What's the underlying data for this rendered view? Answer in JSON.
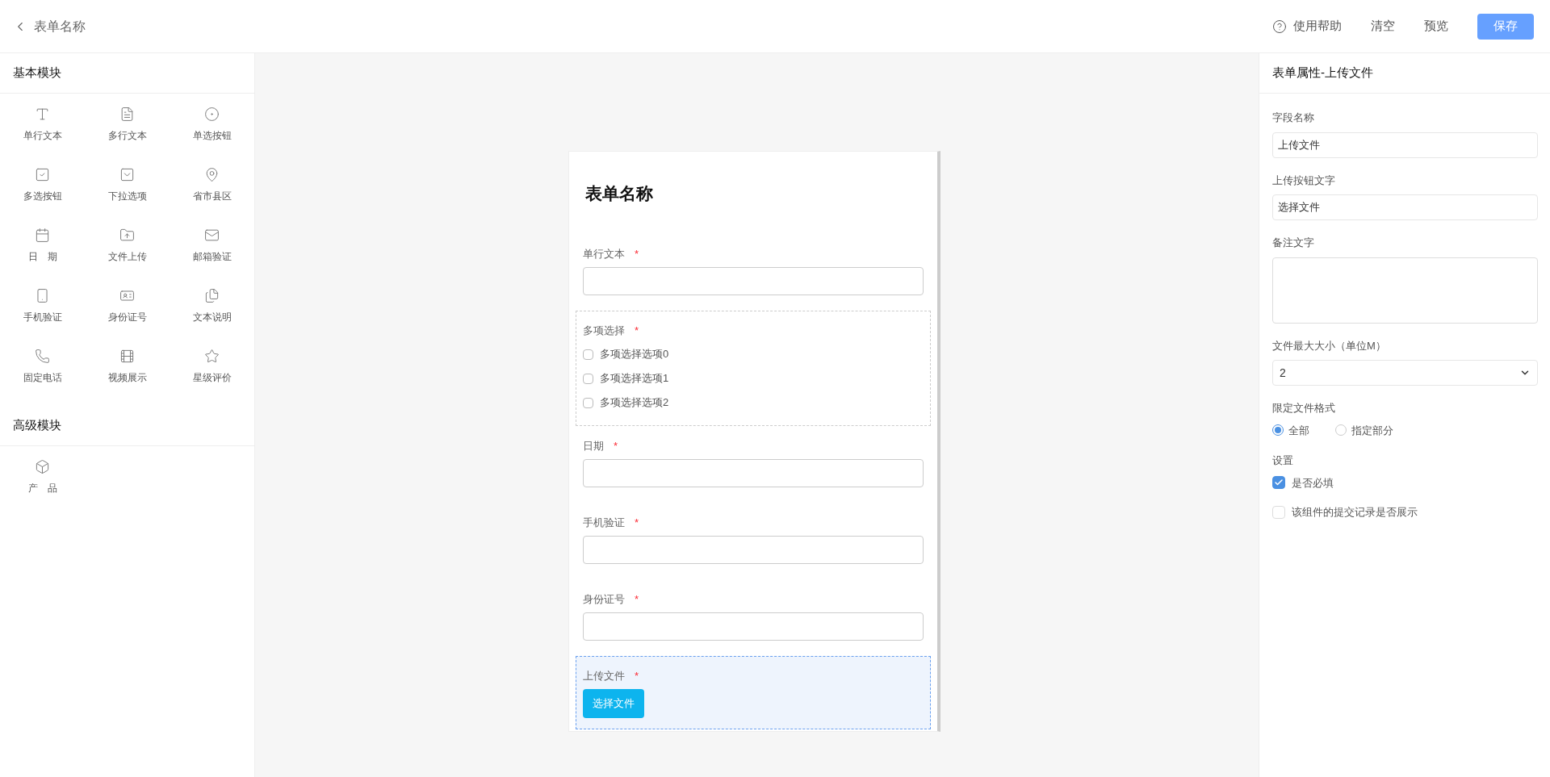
{
  "header": {
    "title": "表单名称",
    "actions": [
      {
        "kind": "help",
        "label": "使用帮助"
      },
      {
        "kind": "link",
        "label": "清空"
      },
      {
        "kind": "link",
        "label": "预览"
      },
      {
        "kind": "primary",
        "label": "保存"
      }
    ]
  },
  "palette": {
    "sections": [
      {
        "title": "基本模块",
        "items": [
          {
            "label": "单行文本"
          },
          {
            "label": "多行文本"
          },
          {
            "label": "单选按钮"
          },
          {
            "label": "多选按钮"
          },
          {
            "label": "下拉选项"
          },
          {
            "label": "省市县区"
          },
          {
            "label": "日　期"
          },
          {
            "label": "文件上传"
          },
          {
            "label": "邮箱验证"
          },
          {
            "label": "手机验证"
          },
          {
            "label": "身份证号"
          },
          {
            "label": "文本说明"
          },
          {
            "label": "固定电话"
          },
          {
            "label": "视频展示"
          },
          {
            "label": "星级评价"
          }
        ]
      },
      {
        "title": "高级模块",
        "items": [
          {
            "label": "产　品"
          }
        ]
      }
    ]
  },
  "form": {
    "title": "表单名称",
    "fields": [
      {
        "kind": "input",
        "label": "单行文本",
        "required_mark": "*",
        "selected": false
      },
      {
        "kind": "checkboxes",
        "label": "多项选择",
        "required_mark": "*",
        "selected": false,
        "options": [
          {
            "label": "多项选择选项0",
            "checked": false
          },
          {
            "label": "多项选择选项1",
            "checked": false
          },
          {
            "label": "多项选择选项2",
            "checked": false
          }
        ]
      },
      {
        "kind": "input",
        "label": "日期",
        "required_mark": "*",
        "selected": false
      },
      {
        "kind": "input",
        "label": "手机验证",
        "required_mark": "*",
        "selected": false
      },
      {
        "kind": "input",
        "label": "身份证号",
        "required_mark": "*",
        "selected": false
      },
      {
        "kind": "upload",
        "label": "上传文件",
        "required_mark": "*",
        "selected": true,
        "button": "选择文件"
      }
    ]
  },
  "properties": {
    "title": "表单属性-上传文件",
    "fields": [
      {
        "kind": "input",
        "label": "字段名称",
        "value": "上传文件"
      },
      {
        "kind": "input",
        "label": "上传按钮文字",
        "value": "选择文件"
      },
      {
        "kind": "textarea",
        "label": "备注文字"
      },
      {
        "kind": "select",
        "label": "文件最大大小（单位M）",
        "value": "2"
      },
      {
        "kind": "radio",
        "label": "限定文件格式",
        "options": [
          {
            "label": "全部",
            "selected": true
          },
          {
            "label": "指定部分",
            "selected": false
          }
        ]
      },
      {
        "kind": "checks",
        "label": "设置",
        "options": [
          {
            "label": "是否必填",
            "checked": true
          },
          {
            "label": "该组件的提交记录是否展示",
            "checked": false
          }
        ]
      }
    ]
  }
}
